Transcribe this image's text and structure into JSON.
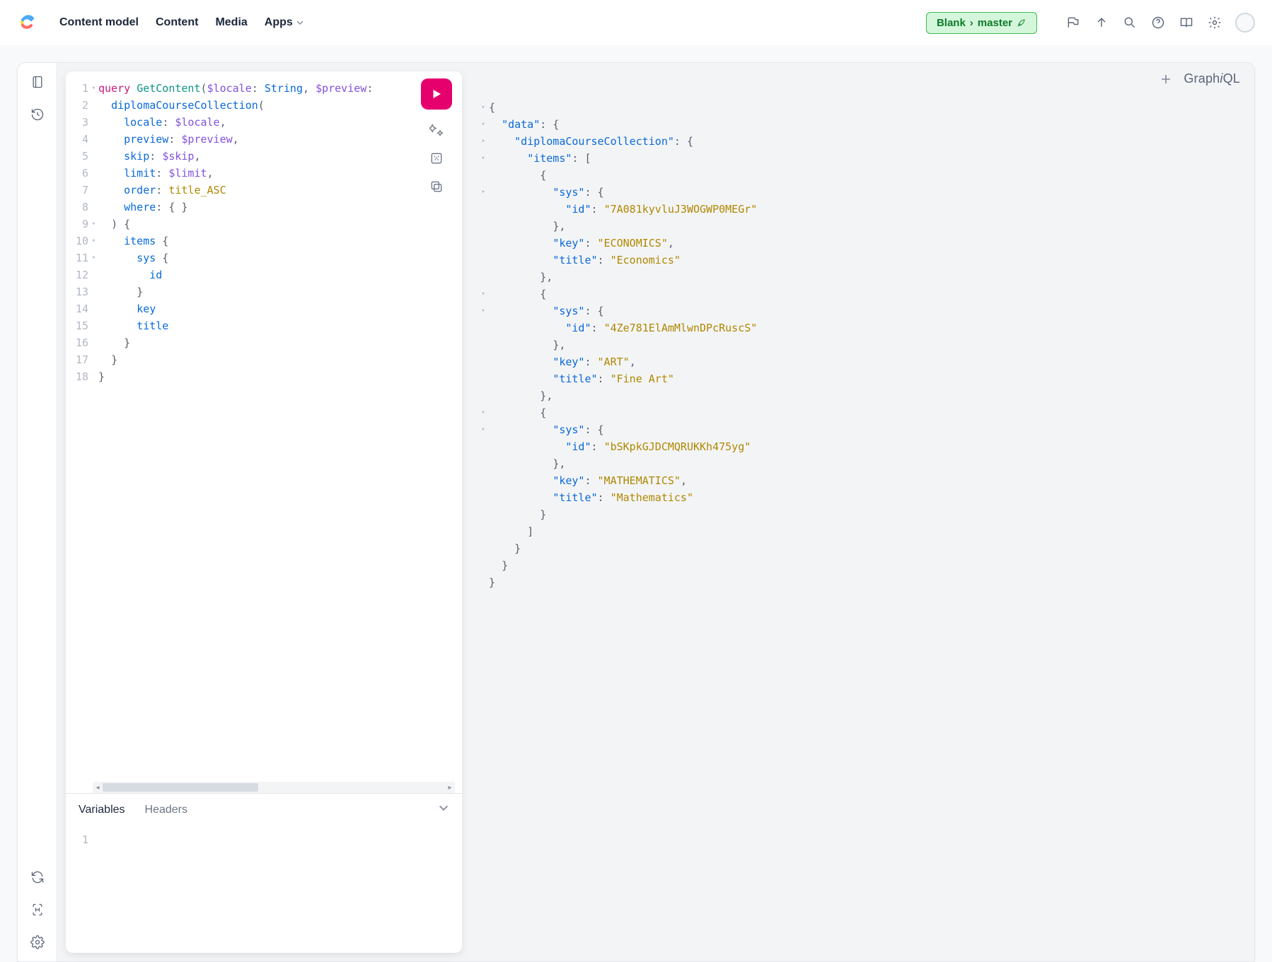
{
  "nav": {
    "links": [
      "Content model",
      "Content",
      "Media",
      "Apps"
    ],
    "env": {
      "space": "Blank",
      "env": "master"
    }
  },
  "query": {
    "lines": [
      {
        "n": "1",
        "fold": true,
        "tokens": [
          [
            "kw-query",
            "query "
          ],
          [
            "kw-name",
            "GetContent"
          ],
          [
            "punct",
            "("
          ],
          [
            "var",
            "$locale"
          ],
          [
            "punct",
            ": "
          ],
          [
            "type",
            "String"
          ],
          [
            "punct",
            ", "
          ],
          [
            "var",
            "$preview"
          ],
          [
            "punct",
            ":"
          ]
        ]
      },
      {
        "n": "2",
        "fold": false,
        "tokens": [
          [
            "plain",
            "  "
          ],
          [
            "field",
            "diplomaCourseCollection"
          ],
          [
            "punct",
            "("
          ]
        ]
      },
      {
        "n": "3",
        "fold": false,
        "tokens": [
          [
            "plain",
            "    "
          ],
          [
            "field",
            "locale"
          ],
          [
            "punct",
            ": "
          ],
          [
            "var",
            "$locale"
          ],
          [
            "punct",
            ","
          ]
        ]
      },
      {
        "n": "4",
        "fold": false,
        "tokens": [
          [
            "plain",
            "    "
          ],
          [
            "field",
            "preview"
          ],
          [
            "punct",
            ": "
          ],
          [
            "var",
            "$preview"
          ],
          [
            "punct",
            ","
          ]
        ]
      },
      {
        "n": "5",
        "fold": false,
        "tokens": [
          [
            "plain",
            "    "
          ],
          [
            "field",
            "skip"
          ],
          [
            "punct",
            ": "
          ],
          [
            "var",
            "$skip"
          ],
          [
            "punct",
            ","
          ]
        ]
      },
      {
        "n": "6",
        "fold": false,
        "tokens": [
          [
            "plain",
            "    "
          ],
          [
            "field",
            "limit"
          ],
          [
            "punct",
            ": "
          ],
          [
            "var",
            "$limit"
          ],
          [
            "punct",
            ","
          ]
        ]
      },
      {
        "n": "7",
        "fold": false,
        "tokens": [
          [
            "plain",
            "    "
          ],
          [
            "field",
            "order"
          ],
          [
            "punct",
            ": "
          ],
          [
            "enum",
            "title_ASC"
          ]
        ]
      },
      {
        "n": "8",
        "fold": false,
        "tokens": [
          [
            "plain",
            "    "
          ],
          [
            "field",
            "where"
          ],
          [
            "punct",
            ": { }"
          ]
        ]
      },
      {
        "n": "9",
        "fold": true,
        "tokens": [
          [
            "plain",
            "  "
          ],
          [
            "punct",
            ") {"
          ]
        ]
      },
      {
        "n": "10",
        "fold": true,
        "tokens": [
          [
            "plain",
            "    "
          ],
          [
            "field",
            "items"
          ],
          [
            "punct",
            " {"
          ]
        ]
      },
      {
        "n": "11",
        "fold": true,
        "tokens": [
          [
            "plain",
            "      "
          ],
          [
            "field",
            "sys"
          ],
          [
            "punct",
            " {"
          ]
        ]
      },
      {
        "n": "12",
        "fold": false,
        "tokens": [
          [
            "plain",
            "        "
          ],
          [
            "field",
            "id"
          ]
        ]
      },
      {
        "n": "13",
        "fold": false,
        "tokens": [
          [
            "plain",
            "      "
          ],
          [
            "punct",
            "}"
          ]
        ]
      },
      {
        "n": "14",
        "fold": false,
        "tokens": [
          [
            "plain",
            "      "
          ],
          [
            "field",
            "key"
          ]
        ]
      },
      {
        "n": "15",
        "fold": false,
        "tokens": [
          [
            "plain",
            "      "
          ],
          [
            "field",
            "title"
          ]
        ]
      },
      {
        "n": "16",
        "fold": false,
        "tokens": [
          [
            "plain",
            "    "
          ],
          [
            "punct",
            "}"
          ]
        ]
      },
      {
        "n": "17",
        "fold": false,
        "tokens": [
          [
            "plain",
            "  "
          ],
          [
            "punct",
            "}"
          ]
        ]
      },
      {
        "n": "18",
        "fold": false,
        "tokens": [
          [
            "punct",
            "}"
          ]
        ]
      }
    ]
  },
  "vars": {
    "tabs": {
      "variables": "Variables",
      "headers": "Headers"
    },
    "line1": "1"
  },
  "result": {
    "brand": "GraphiQL",
    "lines": [
      {
        "f": "▾",
        "tokens": [
          [
            "punct",
            "{"
          ]
        ]
      },
      {
        "f": "▾",
        "tokens": [
          [
            "plain",
            "  "
          ],
          [
            "prop",
            "\"data\""
          ],
          [
            "punct",
            ": {"
          ]
        ]
      },
      {
        "f": "▾",
        "tokens": [
          [
            "plain",
            "    "
          ],
          [
            "prop",
            "\"diplomaCourseCollection\""
          ],
          [
            "punct",
            ": {"
          ]
        ]
      },
      {
        "f": "▾",
        "tokens": [
          [
            "plain",
            "      "
          ],
          [
            "prop",
            "\"items\""
          ],
          [
            "punct",
            ": ["
          ]
        ]
      },
      {
        "f": "",
        "tokens": [
          [
            "plain",
            "        "
          ],
          [
            "punct",
            "{"
          ]
        ]
      },
      {
        "f": "▾",
        "tokens": [
          [
            "plain",
            "          "
          ],
          [
            "prop",
            "\"sys\""
          ],
          [
            "punct",
            ": {"
          ]
        ]
      },
      {
        "f": "",
        "tokens": [
          [
            "plain",
            "            "
          ],
          [
            "prop",
            "\"id\""
          ],
          [
            "punct",
            ": "
          ],
          [
            "str",
            "\"7A081kyvluJ3WOGWP0MEGr\""
          ]
        ]
      },
      {
        "f": "",
        "tokens": [
          [
            "plain",
            "          "
          ],
          [
            "punct",
            "},"
          ]
        ]
      },
      {
        "f": "",
        "tokens": [
          [
            "plain",
            "          "
          ],
          [
            "prop",
            "\"key\""
          ],
          [
            "punct",
            ": "
          ],
          [
            "str",
            "\"ECONOMICS\""
          ],
          [
            "punct",
            ","
          ]
        ]
      },
      {
        "f": "",
        "tokens": [
          [
            "plain",
            "          "
          ],
          [
            "prop",
            "\"title\""
          ],
          [
            "punct",
            ": "
          ],
          [
            "str",
            "\"Economics\""
          ]
        ]
      },
      {
        "f": "",
        "tokens": [
          [
            "plain",
            "        "
          ],
          [
            "punct",
            "},"
          ]
        ]
      },
      {
        "f": "▾",
        "tokens": [
          [
            "plain",
            "        "
          ],
          [
            "punct",
            "{"
          ]
        ]
      },
      {
        "f": "▾",
        "tokens": [
          [
            "plain",
            "          "
          ],
          [
            "prop",
            "\"sys\""
          ],
          [
            "punct",
            ": {"
          ]
        ]
      },
      {
        "f": "",
        "tokens": [
          [
            "plain",
            "            "
          ],
          [
            "prop",
            "\"id\""
          ],
          [
            "punct",
            ": "
          ],
          [
            "str",
            "\"4Ze781ElAmMlwnDPcRuscS\""
          ]
        ]
      },
      {
        "f": "",
        "tokens": [
          [
            "plain",
            "          "
          ],
          [
            "punct",
            "},"
          ]
        ]
      },
      {
        "f": "",
        "tokens": [
          [
            "plain",
            "          "
          ],
          [
            "prop",
            "\"key\""
          ],
          [
            "punct",
            ": "
          ],
          [
            "str",
            "\"ART\""
          ],
          [
            "punct",
            ","
          ]
        ]
      },
      {
        "f": "",
        "tokens": [
          [
            "plain",
            "          "
          ],
          [
            "prop",
            "\"title\""
          ],
          [
            "punct",
            ": "
          ],
          [
            "str",
            "\"Fine Art\""
          ]
        ]
      },
      {
        "f": "",
        "tokens": [
          [
            "plain",
            "        "
          ],
          [
            "punct",
            "},"
          ]
        ]
      },
      {
        "f": "▾",
        "tokens": [
          [
            "plain",
            "        "
          ],
          [
            "punct",
            "{"
          ]
        ]
      },
      {
        "f": "▾",
        "tokens": [
          [
            "plain",
            "          "
          ],
          [
            "prop",
            "\"sys\""
          ],
          [
            "punct",
            ": {"
          ]
        ]
      },
      {
        "f": "",
        "tokens": [
          [
            "plain",
            "            "
          ],
          [
            "prop",
            "\"id\""
          ],
          [
            "punct",
            ": "
          ],
          [
            "str",
            "\"bSKpkGJDCMQRUKKh475yg\""
          ]
        ]
      },
      {
        "f": "",
        "tokens": [
          [
            "plain",
            "          "
          ],
          [
            "punct",
            "},"
          ]
        ]
      },
      {
        "f": "",
        "tokens": [
          [
            "plain",
            "          "
          ],
          [
            "prop",
            "\"key\""
          ],
          [
            "punct",
            ": "
          ],
          [
            "str",
            "\"MATHEMATICS\""
          ],
          [
            "punct",
            ","
          ]
        ]
      },
      {
        "f": "",
        "tokens": [
          [
            "plain",
            "          "
          ],
          [
            "prop",
            "\"title\""
          ],
          [
            "punct",
            ": "
          ],
          [
            "str",
            "\"Mathematics\""
          ]
        ]
      },
      {
        "f": "",
        "tokens": [
          [
            "plain",
            "        "
          ],
          [
            "punct",
            "}"
          ]
        ]
      },
      {
        "f": "",
        "tokens": [
          [
            "plain",
            "      "
          ],
          [
            "punct",
            "]"
          ]
        ]
      },
      {
        "f": "",
        "tokens": [
          [
            "plain",
            "    "
          ],
          [
            "punct",
            "}"
          ]
        ]
      },
      {
        "f": "",
        "tokens": [
          [
            "plain",
            "  "
          ],
          [
            "punct",
            "}"
          ]
        ]
      },
      {
        "f": "",
        "tokens": [
          [
            "punct",
            "}"
          ]
        ]
      }
    ]
  }
}
